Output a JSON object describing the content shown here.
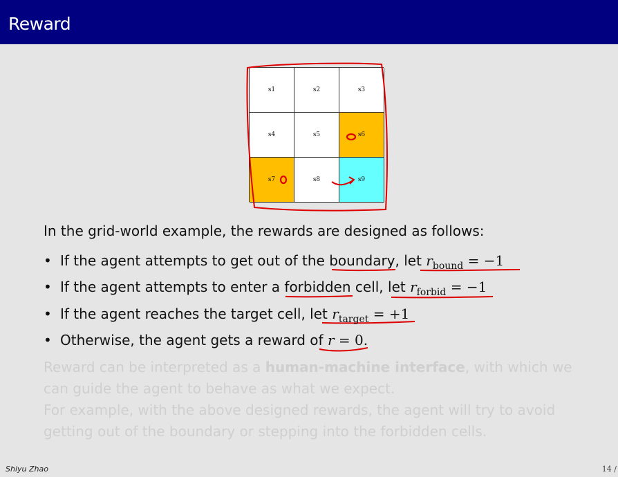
{
  "slide": {
    "title": "Reward"
  },
  "grid": {
    "cells": [
      {
        "label": "s1",
        "type": "normal"
      },
      {
        "label": "s2",
        "type": "normal"
      },
      {
        "label": "s3",
        "type": "normal"
      },
      {
        "label": "s4",
        "type": "normal"
      },
      {
        "label": "s5",
        "type": "normal"
      },
      {
        "label": "s6",
        "type": "forbidden"
      },
      {
        "label": "s7",
        "type": "forbidden"
      },
      {
        "label": "s8",
        "type": "normal"
      },
      {
        "label": "s9",
        "type": "target"
      }
    ],
    "colors": {
      "forbidden": "#ffbf00",
      "target": "#66ffff",
      "normal": "#ffffff",
      "annotation": "#dd0000"
    }
  },
  "content": {
    "intro": "In the grid-world example, the rewards are designed as follows:",
    "bullets": [
      {
        "pre": "If the agent attempts to get out of the ",
        "key": "boundary",
        "mid": ", let ",
        "var": "r",
        "sub": "bound",
        "eq": " = −1"
      },
      {
        "pre": "If the agent attempts to enter a ",
        "key": "forbidden",
        "mid": " cell, let ",
        "var": "r",
        "sub": "forbid",
        "eq": " = −1"
      },
      {
        "pre": "If the agent reaches the target cell, let ",
        "key": "",
        "mid": "",
        "var": "r",
        "sub": "target",
        "eq": " = +1"
      },
      {
        "pre": "Otherwise, the agent gets a reward of ",
        "key": "",
        "mid": "",
        "var": "r",
        "sub": "",
        "eq": " = 0."
      }
    ],
    "faded": {
      "p1_a": "Reward can be interpreted as a ",
      "p1_bold": "human-machine interface",
      "p1_b": ", with which we can guide the agent to behave as what we expect.",
      "p2": "For example, with the above designed rewards, the agent will try to avoid getting out of the boundary or stepping into the forbidden cells."
    }
  },
  "footer": {
    "author": "Shiyu Zhao",
    "page": "14 /"
  }
}
